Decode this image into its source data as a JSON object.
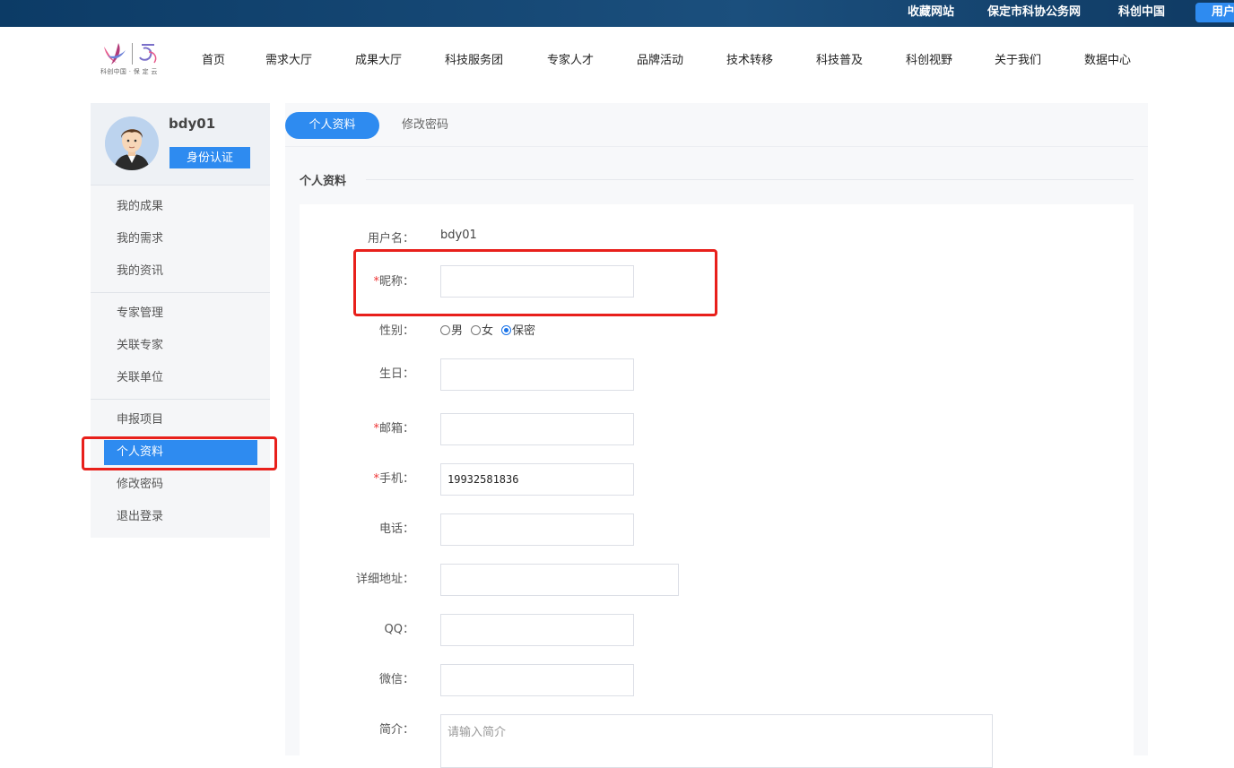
{
  "topbar": {
    "links": [
      "收藏网站",
      "保定市科协公务网",
      "科创中国"
    ],
    "user_button": "用户"
  },
  "logo": {
    "text": "科创中国 · 保 定 云"
  },
  "nav": {
    "items": [
      "首页",
      "需求大厅",
      "成果大厅",
      "科技服务团",
      "专家人才",
      "品牌活动",
      "技术转移",
      "科技普及",
      "科创视野",
      "关于我们",
      "数据中心"
    ]
  },
  "sidebar": {
    "username": "bdy01",
    "verify_button": "身份认证",
    "groups": [
      [
        "我的成果",
        "我的需求",
        "我的资讯"
      ],
      [
        "专家管理",
        "关联专家",
        "关联单位"
      ],
      [
        "申报项目",
        "个人资料",
        "修改密码",
        "退出登录"
      ]
    ],
    "active_item": "个人资料"
  },
  "tabs": {
    "active": "个人资料",
    "inactive": "修改密码"
  },
  "section_title": "个人资料",
  "form": {
    "username_label": "用户名：",
    "username_value": "bdy01",
    "nickname_label": "昵称：",
    "gender_label": "性别：",
    "gender_options": [
      "男",
      "女",
      "保密"
    ],
    "gender_selected": "保密",
    "birthday_label": "生日：",
    "email_label": "邮箱：",
    "phone_label": "手机：",
    "phone_value": "19932581836",
    "tel_label": "电话：",
    "address_label": "详细地址：",
    "qq_label": "QQ：",
    "wechat_label": "微信：",
    "intro_label": "简介：",
    "intro_placeholder": "请输入简介",
    "required_mark": "*"
  }
}
